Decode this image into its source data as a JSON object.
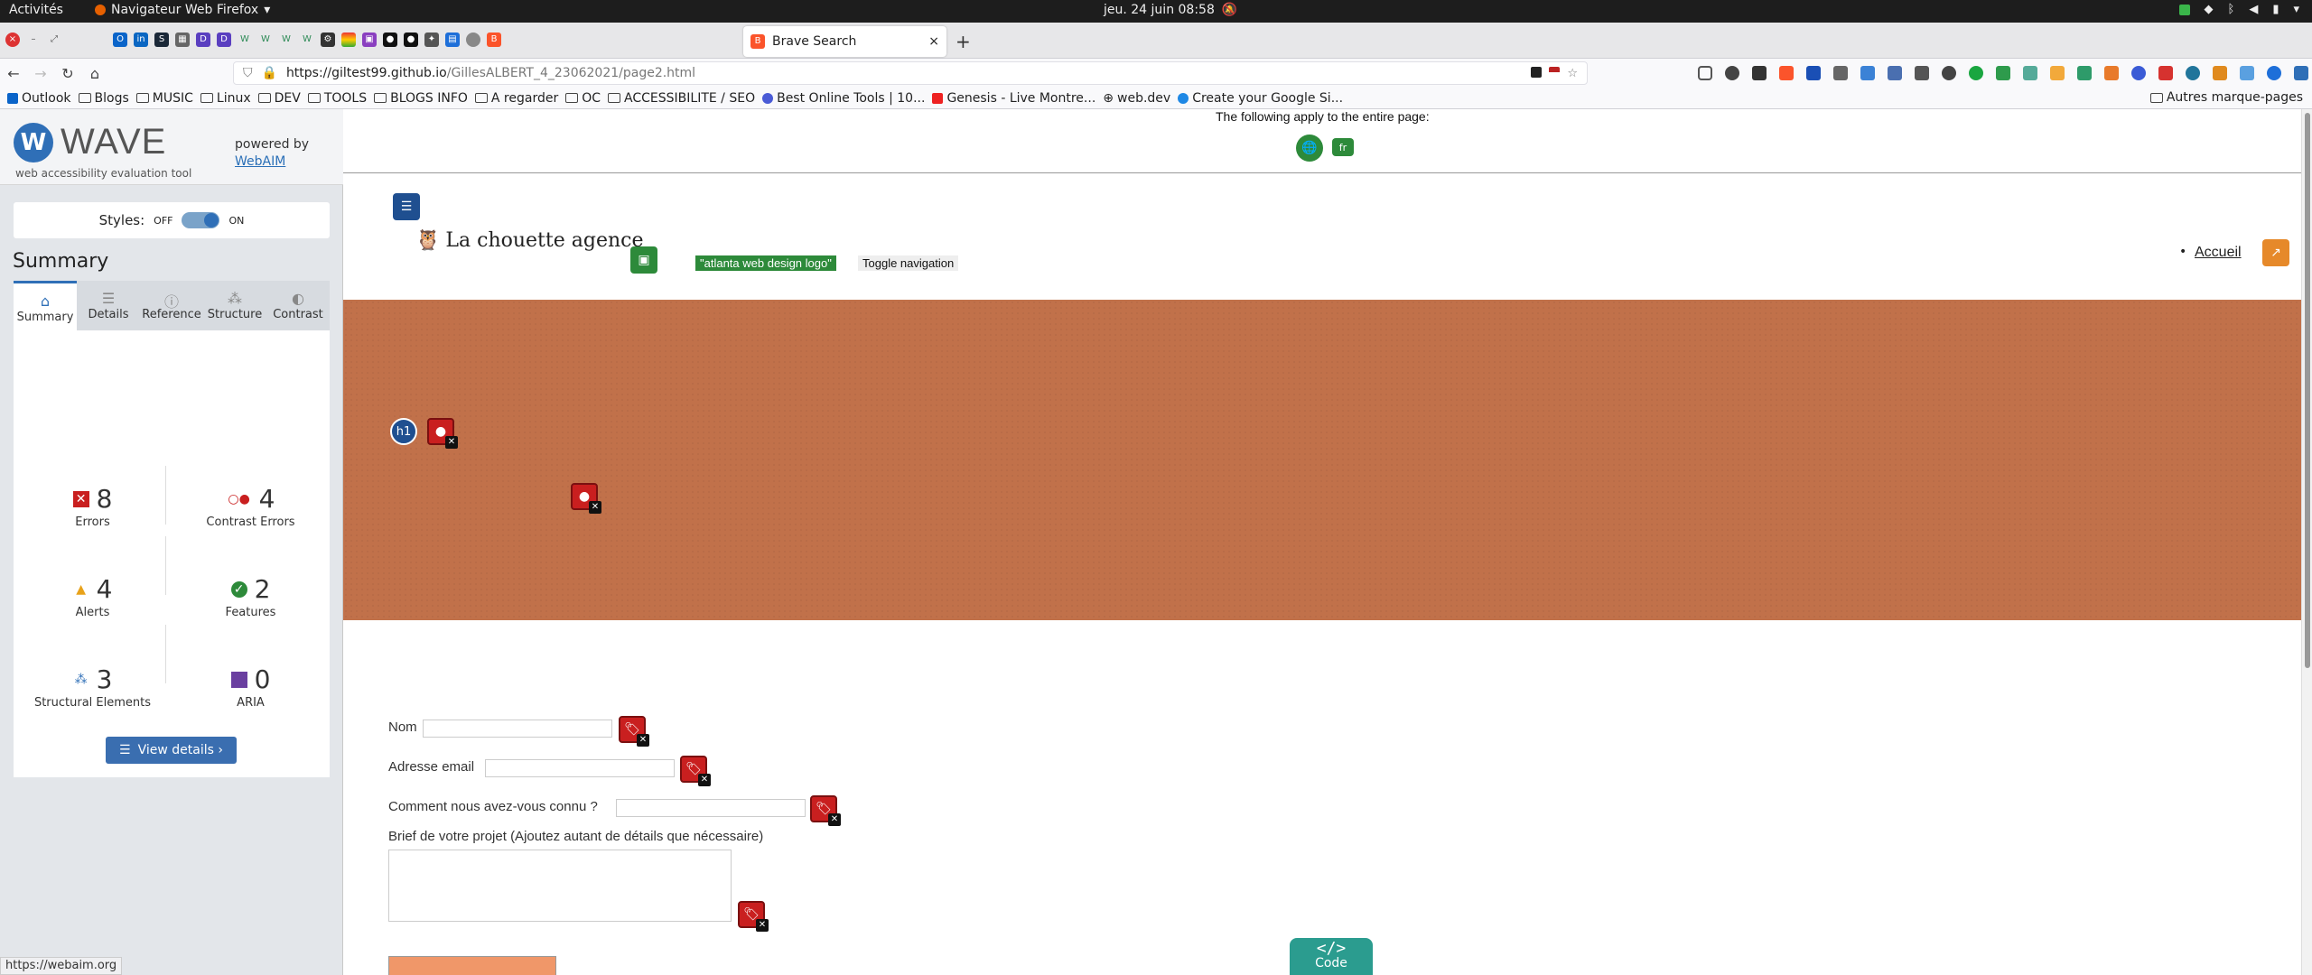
{
  "system": {
    "activities": "Activités",
    "app_name": "Navigateur Web Firefox",
    "clock": "jeu. 24 juin  08:58"
  },
  "tabs": {
    "active_title": "Brave Search",
    "new_tab": "+"
  },
  "navbar": {
    "url_host": "https://giltest99.github.io",
    "url_path": "/GillesALBERT_4_23062021/page2.html"
  },
  "bookmarks": [
    "Outlook",
    "Blogs",
    "MUSIC",
    "Linux",
    "DEV",
    "TOOLS",
    "BLOGS INFO",
    "A regarder",
    "OC",
    "ACCESSIBILITE / SEO",
    "Best Online Tools | 10...",
    "Genesis - Live Montre...",
    "web.dev",
    "Create your Google Si..."
  ],
  "bookmarks_other": "Autres marque-pages",
  "wave": {
    "logo_text": "WAVE",
    "tagline": "web accessibility evaluation tool",
    "powered_by": "powered by",
    "webaim": "WebAIM",
    "styles_label": "Styles:",
    "off": "OFF",
    "on": "ON",
    "summary_title": "Summary",
    "tabs": [
      "Summary",
      "Details",
      "Reference",
      "Structure",
      "Contrast"
    ],
    "stats": {
      "errors": {
        "value": "8",
        "label": "Errors"
      },
      "contrast": {
        "value": "4",
        "label": "Contrast Errors"
      },
      "alerts": {
        "value": "4",
        "label": "Alerts"
      },
      "features": {
        "value": "2",
        "label": "Features"
      },
      "structural": {
        "value": "3",
        "label": "Structural Elements"
      },
      "aria": {
        "value": "0",
        "label": "ARIA"
      }
    },
    "view_details": "View details ›"
  },
  "status_url": "https://webaim.org",
  "page": {
    "applies_note": "The following apply to the entire page:",
    "lang_icon": "fr",
    "site_title": "La chouette agence",
    "alt_logo": "\"atlanta web design logo\"",
    "toggle_nav": "Toggle navigation",
    "nav_accueil": "Accueil",
    "heading_icon": "h1",
    "form": {
      "nom": "Nom",
      "email": "Adresse email",
      "connu": "Comment nous avez-vous connu ?",
      "brief": "Brief de votre projet (Ajoutez autant de détails que nécessaire)"
    },
    "code_label": "Code",
    "code_glyph": "</>"
  },
  "colors": {
    "hero": "#c1714a",
    "wave_blue": "#2f6fb7",
    "error_red": "#c91f1f"
  }
}
